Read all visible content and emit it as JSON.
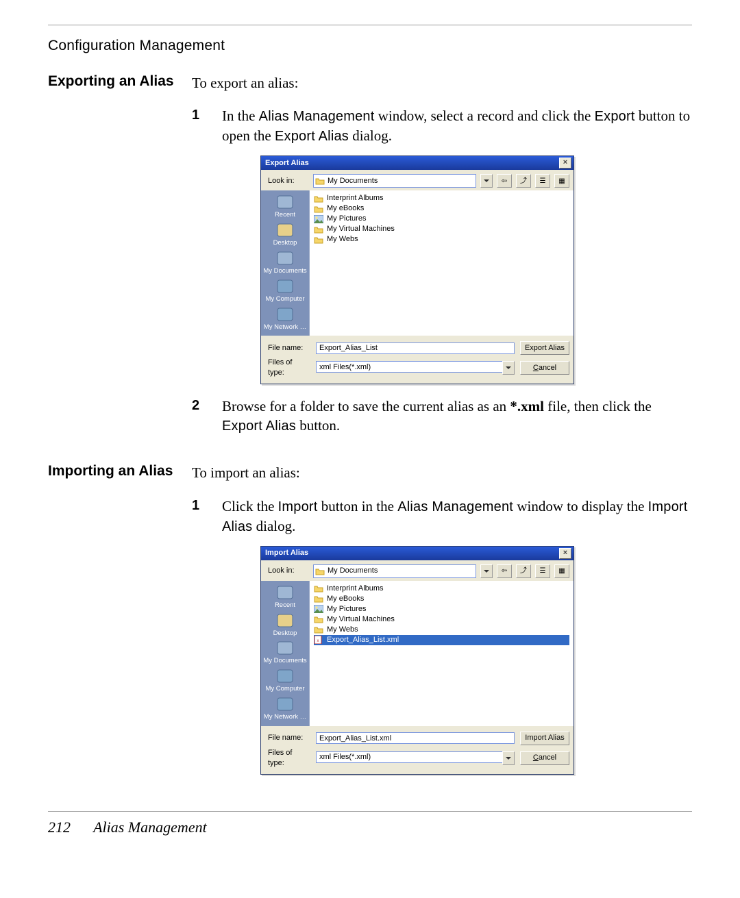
{
  "page": {
    "chapter": "Configuration Management",
    "footer_page": "212",
    "footer_title": "Alias Management"
  },
  "section1": {
    "heading": "Exporting an Alias",
    "intro": "To export an alias:",
    "step1_pre": "In the ",
    "step1_ui1": "Alias Management",
    "step1_mid": " window, select a record and click the ",
    "step1_ui2": "Export",
    "step1_mid2": " button to open the ",
    "step1_ui3": "Export Alias",
    "step1_post": " dialog.",
    "step2_pre": "Browse for a folder to save the current alias as an ",
    "step2_bold": "*.xml",
    "step2_mid": " file, then click the ",
    "step2_ui": "Export Alias",
    "step2_post": " button."
  },
  "section2": {
    "heading": "Importing an Alias",
    "intro": "To import an alias:",
    "step1_pre": "Click the ",
    "step1_ui1": "Import",
    "step1_mid": " button in the ",
    "step1_ui2": "Alias Management",
    "step1_mid2": " window to display the ",
    "step1_ui3": "Import Alias",
    "step1_post": " dialog."
  },
  "exportDialog": {
    "title": "Export Alias",
    "lookin_label": "Look in:",
    "lookin_value": "My Documents",
    "places": [
      "Recent",
      "Desktop",
      "My Documents",
      "My Computer",
      "My Network …"
    ],
    "items": [
      {
        "name": "Interprint Albums",
        "kind": "folder"
      },
      {
        "name": "My eBooks",
        "kind": "folder"
      },
      {
        "name": "My Pictures",
        "kind": "pic"
      },
      {
        "name": "My Virtual Machines",
        "kind": "folder"
      },
      {
        "name": "My Webs",
        "kind": "folder"
      }
    ],
    "filename_label": "File name:",
    "filename_value": "Export_Alias_List",
    "filetype_label": "Files of type:",
    "filetype_value": "xml Files(*.xml)",
    "primary_button": "Export Alias",
    "cancel_button": "Cancel"
  },
  "importDialog": {
    "title": "Import Alias",
    "lookin_label": "Look in:",
    "lookin_value": "My Documents",
    "places": [
      "Recent",
      "Desktop",
      "My Documents",
      "My Computer",
      "My Network …"
    ],
    "items": [
      {
        "name": "Interprint Albums",
        "kind": "folder"
      },
      {
        "name": "My eBooks",
        "kind": "folder"
      },
      {
        "name": "My Pictures",
        "kind": "pic"
      },
      {
        "name": "My Virtual Machines",
        "kind": "folder"
      },
      {
        "name": "My Webs",
        "kind": "folder"
      },
      {
        "name": "Export_Alias_List.xml",
        "kind": "xml",
        "selected": true
      }
    ],
    "filename_label": "File name:",
    "filename_value": "Export_Alias_List.xml",
    "filetype_label": "Files of type:",
    "filetype_value": "xml Files(*.xml)",
    "primary_button": "Import Alias",
    "cancel_button": "Cancel"
  }
}
